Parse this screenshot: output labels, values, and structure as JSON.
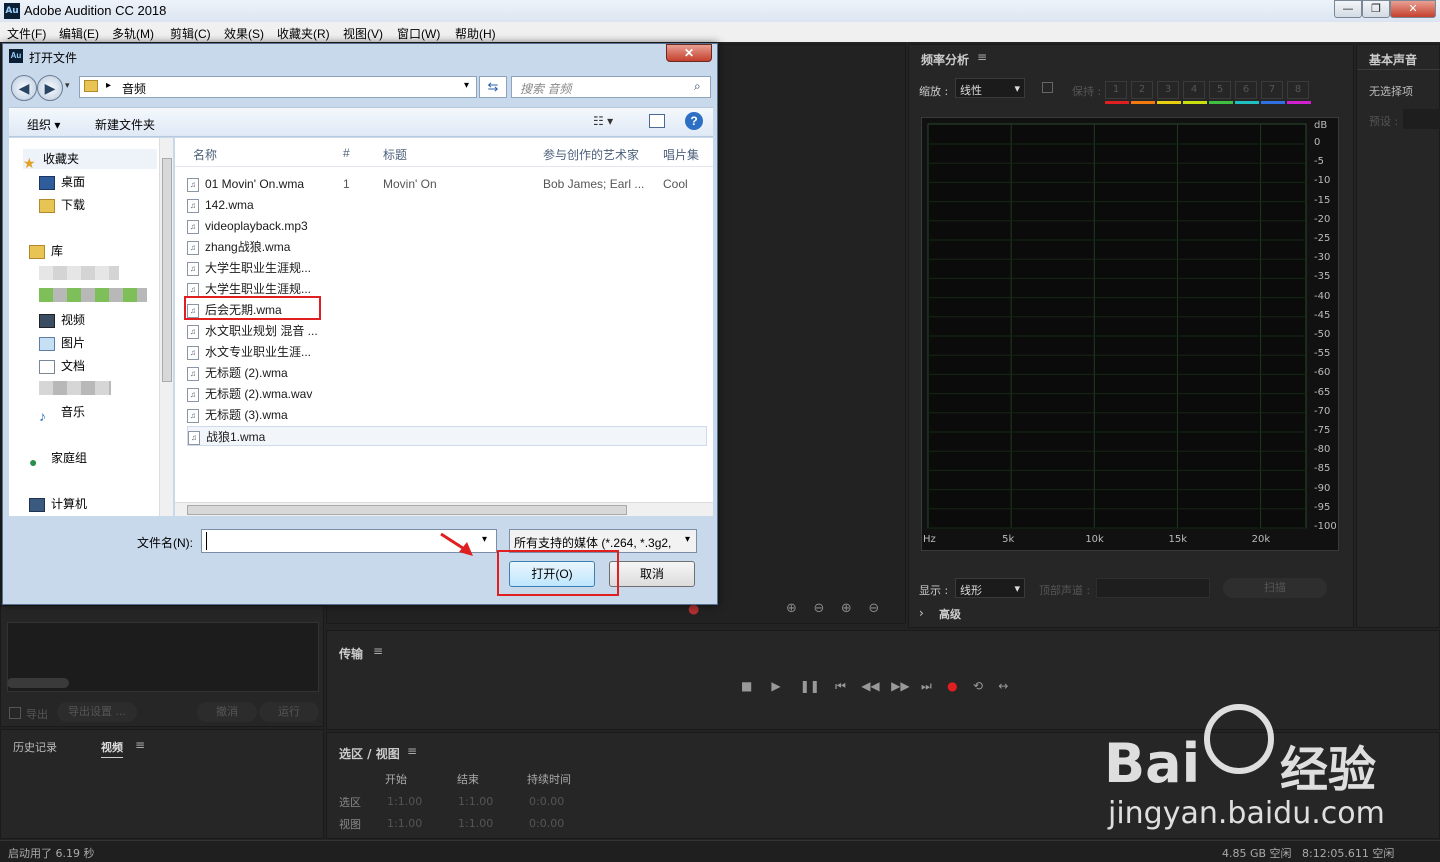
{
  "app": {
    "title": "Adobe Audition CC 2018",
    "icon_label": "Au",
    "window_buttons": [
      "—",
      "❐",
      "✕"
    ]
  },
  "menu": [
    "文件(F)",
    "编辑(E)",
    "多轨(M)",
    "剪辑(C)",
    "效果(S)",
    "收藏夹(R)",
    "视图(V)",
    "窗口(W)",
    "帮助(H)"
  ],
  "frequency_panel": {
    "title": "频率分析",
    "zoom_label": "缩放 :",
    "zoom_value": "线性",
    "hold_label": "保持 :",
    "hold_slots": [
      "1",
      "2",
      "3",
      "4",
      "5",
      "6",
      "7",
      "8"
    ],
    "hold_colors": [
      "#e02020",
      "#f07a10",
      "#e8d010",
      "#c8e010",
      "#40c040",
      "#20c0c0",
      "#3070e0",
      "#d020d0"
    ],
    "db_labels": [
      "dB",
      "0",
      "-5",
      "-10",
      "-15",
      "-20",
      "-25",
      "-30",
      "-35",
      "-40",
      "-45",
      "-50",
      "-55",
      "-60",
      "-65",
      "-70",
      "-75",
      "-80",
      "-85",
      "-90",
      "-95",
      "-100"
    ],
    "hz_labels": [
      "Hz",
      "5k",
      "10k",
      "15k",
      "20k"
    ],
    "display_label": "显示 :",
    "display_value": "线形",
    "channel_label": "顶部声道 :",
    "scan_label": "扫描",
    "advanced_label": "高级"
  },
  "essential_sound": {
    "title": "基本声音",
    "no_selection": "无选择项",
    "preset_label": "预设 :"
  },
  "transport": {
    "title": "传输"
  },
  "selection_view": {
    "title": "选区 / 视图",
    "col_start": "开始",
    "col_end": "结束",
    "col_duration": "持续时间",
    "row_selection": "选区",
    "row_view": "视图",
    "sel_start": "1:1.00",
    "sel_end": "1:1.00",
    "sel_duration": "0:0.00",
    "view_start": "1:1.00",
    "view_end": "1:1.00",
    "view_duration": "0:0.00"
  },
  "left_panel": {
    "export_label": "导出",
    "export_settings": "导出设置 ...",
    "cancel_label": "撤消",
    "run_label": "运行"
  },
  "history_tabs": {
    "history": "历史记录",
    "video": "视频"
  },
  "status": {
    "startup": "启动用了 6.19 秒",
    "disk": "4.85 GB 空闲",
    "time": "8:12:05.611 空闲"
  },
  "dialog": {
    "title": "打开文件",
    "close": "✕",
    "path_folder": "音频",
    "search_placeholder": "搜索 音频",
    "organize": "组织 ▾",
    "new_folder": "新建文件夹",
    "nav": {
      "favorites": "收藏夹",
      "desktop": "桌面",
      "downloads": "下载",
      "libraries": "库",
      "videos": "视频",
      "pictures": "图片",
      "documents": "文档",
      "music": "音乐",
      "homegroup": "家庭组",
      "computer": "计算机"
    },
    "columns": [
      "名称",
      "#",
      "标题",
      "参与创作的艺术家",
      "唱片集"
    ],
    "files": [
      {
        "name": "01 Movin' On.wma",
        "num": "1",
        "title": "Movin' On",
        "artist": "Bob James; Earl ...",
        "album": "Cool"
      },
      {
        "name": "142.wma",
        "num": "",
        "title": "",
        "artist": "",
        "album": ""
      },
      {
        "name": "videoplayback.mp3",
        "num": "",
        "title": "",
        "artist": "",
        "album": ""
      },
      {
        "name": "zhang战狼.wma",
        "num": "",
        "title": "",
        "artist": "",
        "album": ""
      },
      {
        "name": "大学生职业生涯规...",
        "num": "",
        "title": "",
        "artist": "",
        "album": ""
      },
      {
        "name": "大学生职业生涯规...",
        "num": "",
        "title": "",
        "artist": "",
        "album": ""
      },
      {
        "name": "后会无期.wma",
        "num": "",
        "title": "",
        "artist": "",
        "album": ""
      },
      {
        "name": "水文职业规划 混音 ...",
        "num": "",
        "title": "",
        "artist": "",
        "album": ""
      },
      {
        "name": "水文专业职业生涯...",
        "num": "",
        "title": "",
        "artist": "",
        "album": ""
      },
      {
        "name": "无标题 (2).wma",
        "num": "",
        "title": "",
        "artist": "",
        "album": ""
      },
      {
        "name": "无标题 (2).wma.wav",
        "num": "",
        "title": "",
        "artist": "",
        "album": ""
      },
      {
        "name": "无标题 (3).wma",
        "num": "",
        "title": "",
        "artist": "",
        "album": ""
      },
      {
        "name": "战狼1.wma",
        "num": "",
        "title": "",
        "artist": "",
        "album": ""
      }
    ],
    "filename_label": "文件名(N):",
    "filename_value": "",
    "filter_value": "所有支持的媒体 (*.264, *.3g2,",
    "open_button": "打开(O)",
    "cancel_button": "取消"
  },
  "watermark": {
    "brand": "Bai",
    "brand2": "经验",
    "url": "jingyan.baidu.com"
  }
}
